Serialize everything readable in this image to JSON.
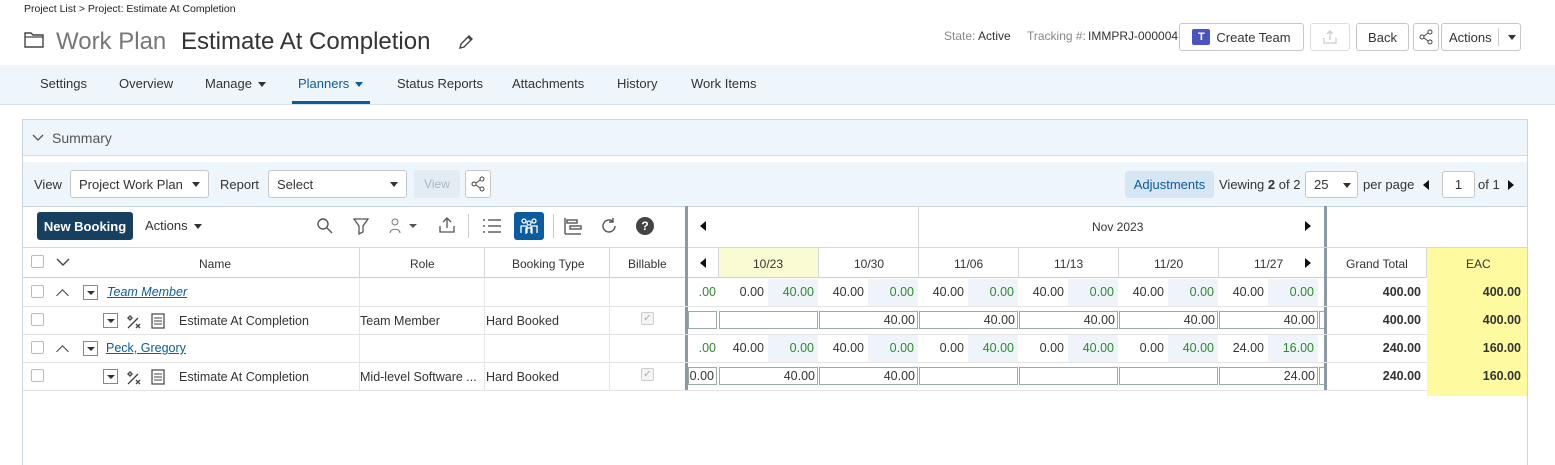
{
  "breadcrumb": "Project List > Project: Estimate At Completion",
  "title": {
    "prefix": "Work Plan",
    "name": "Estimate At Completion"
  },
  "header": {
    "state_label": "State:",
    "state_value": "Active",
    "tracking_label": "Tracking #:",
    "tracking_value": "IMMPRJ-000004",
    "create_team": "Create Team",
    "back": "Back",
    "actions": "Actions"
  },
  "nav": [
    "Settings",
    "Overview",
    "Manage",
    "Planners",
    "Status Reports",
    "Attachments",
    "History",
    "Work Items"
  ],
  "summary": "Summary",
  "toolbar": {
    "view_label": "View",
    "view_value": "Project Work Plan",
    "report_label": "Report",
    "report_value": "Select",
    "view_btn": "View",
    "adjustments": "Adjustments",
    "viewing_prefix": "Viewing",
    "viewing_count": "2",
    "viewing_of": "of 2",
    "per_page_value": "25",
    "per_page_label": "per page",
    "page_value": "1",
    "page_of": "of 1"
  },
  "grid_toolbar": {
    "new_booking": "New Booking",
    "actions": "Actions"
  },
  "columns": {
    "name": "Name",
    "role": "Role",
    "booking_type": "Booking Type",
    "billable": "Billable",
    "month": "Nov 2023",
    "weeks": [
      "10/23",
      "10/30",
      "11/06",
      "11/13",
      "11/20",
      "11/27"
    ],
    "grand_total": "Grand Total",
    "eac": "EAC"
  },
  "rows": [
    {
      "name": "Team Member",
      "role": "",
      "booking_type": "",
      "partial": ".00",
      "weeks": [
        [
          "0.00",
          "40.00"
        ],
        [
          "40.00",
          "0.00"
        ],
        [
          "40.00",
          "0.00"
        ],
        [
          "40.00",
          "0.00"
        ],
        [
          "40.00",
          "0.00"
        ],
        [
          "40.00",
          "0.00"
        ]
      ],
      "grand_total": "400.00",
      "eac": "400.00"
    },
    {
      "name": "Estimate At Completion",
      "role": "Team Member",
      "booking_type": "Hard Booked",
      "partial": "",
      "inputs": [
        "",
        "40.00",
        "40.00",
        "40.00",
        "40.00",
        "40.00"
      ],
      "grand_total": "400.00",
      "eac": "400.00"
    },
    {
      "name": "Peck, Gregory",
      "role": "",
      "booking_type": "",
      "partial": ".00",
      "weeks": [
        [
          "40.00",
          "0.00"
        ],
        [
          "40.00",
          "0.00"
        ],
        [
          "0.00",
          "40.00"
        ],
        [
          "0.00",
          "40.00"
        ],
        [
          "0.00",
          "40.00"
        ],
        [
          "24.00",
          "16.00"
        ]
      ],
      "grand_total": "240.00",
      "eac": "160.00"
    },
    {
      "name": "Estimate At Completion",
      "role": "Mid-level Software ...",
      "booking_type": "Hard Booked",
      "partial": "0.00",
      "inputs": [
        "40.00",
        "40.00",
        "",
        "",
        "",
        "24.00"
      ],
      "grand_total": "240.00",
      "eac": "160.00"
    }
  ],
  "colors": {
    "accent": "#0a5c9e",
    "nav_bg": "#eef5fb",
    "eac_bg": "#fdfaa0",
    "green": "#2c8a2c",
    "primary_btn": "#173f5f"
  }
}
